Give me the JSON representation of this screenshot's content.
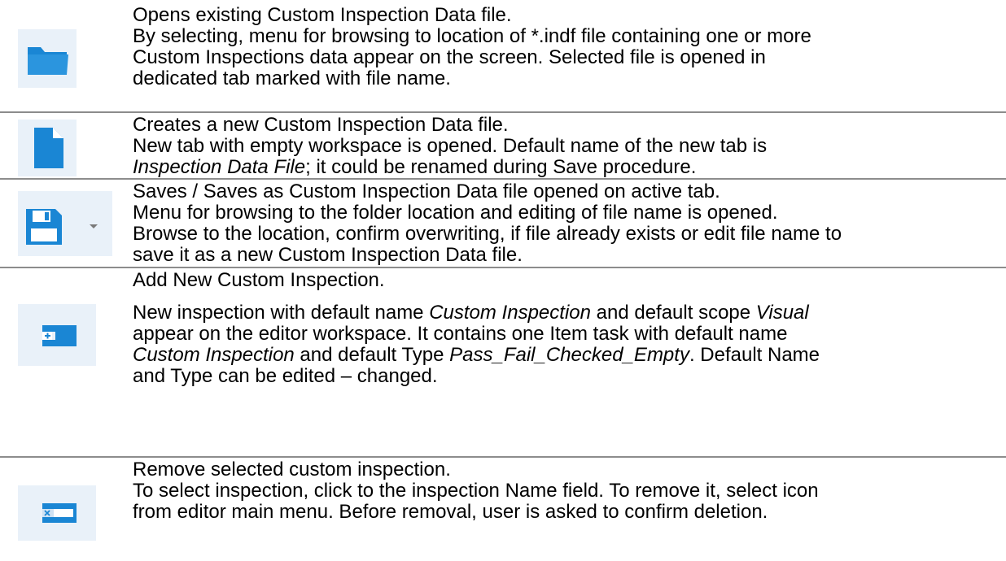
{
  "rows": [
    {
      "icon": "open-folder-icon",
      "lines": [
        "Opens existing Custom Inspection Data file.",
        "By selecting, menu for browsing to location of *.indf file containing one or more",
        "Custom Inspections data appear on the screen. Selected file is opened in",
        "dedicated tab marked with file name."
      ]
    },
    {
      "icon": "new-file-icon",
      "lines": [
        "Creates a new Custom Inspection Data file.",
        "New tab with empty workspace is opened. Default name of the new tab is"
      ],
      "line3_italic": "Inspection Data File",
      "line3_rest": "; it could be renamed during Save procedure."
    },
    {
      "icon": "save-floppy-icon",
      "dropdown_icon": "chevron-down-icon",
      "lines": [
        "Saves / Saves as Custom Inspection Data file opened on active tab.",
        "Menu for browsing to the folder location and editing of file name is opened.",
        "Browse to the location, confirm overwriting, if file already exists or edit file name to",
        "save it as a new Custom Inspection Data file."
      ]
    },
    {
      "icon": "add-inspection-icon",
      "title": "Add New Custom Inspection.",
      "p2_a": "New inspection with default name ",
      "p2_b": "Custom Inspection",
      "p2_c": " and default scope ",
      "p2_d": "Visual",
      "p3": "appear on the editor workspace. It contains one Item task with default name",
      "p4_a": "Custom Inspection",
      "p4_b": " and default Type ",
      "p4_c": "Pass_Fail_Checked_Empty",
      "p4_d": ". Default Name",
      "p5": "and Type can be edited – changed."
    },
    {
      "icon": "remove-inspection-icon",
      "lines": [
        "Remove selected custom inspection.",
        "To select inspection, click to the inspection Name field. To remove it, select icon",
        "from editor main menu. Before removal, user is asked to confirm deletion."
      ]
    }
  ],
  "colors": {
    "icon_blue": "#1a86d4",
    "icon_bg": "#e9f1f9",
    "divider": "#8c8c8c"
  }
}
